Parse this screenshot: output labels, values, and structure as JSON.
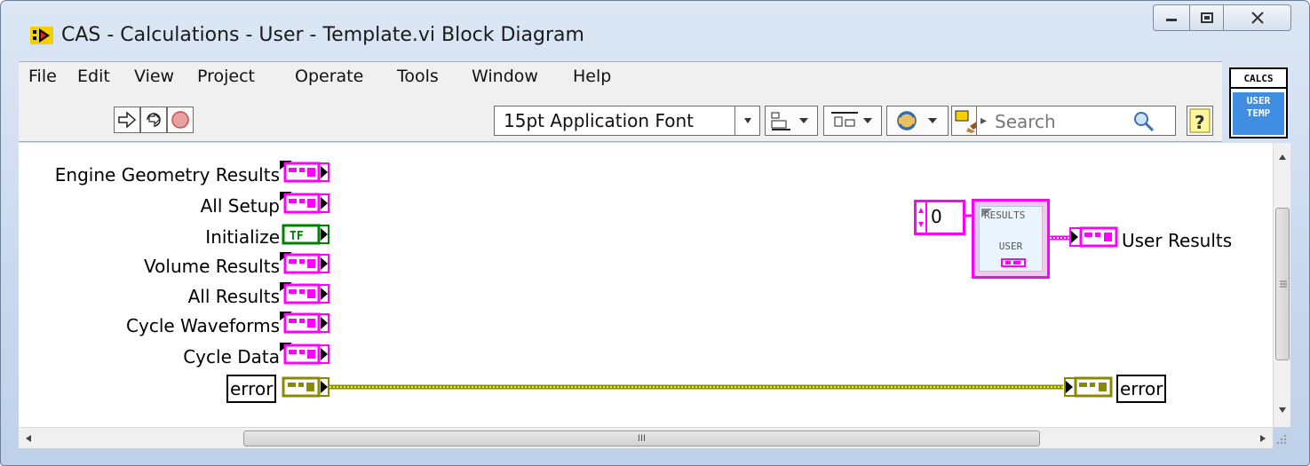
{
  "window": {
    "title": "CAS - Calculations - User - Template.vi Block Diagram",
    "controls": [
      "minimize",
      "maximize",
      "close"
    ]
  },
  "menu": [
    "File",
    "Edit",
    "View",
    "Project",
    "Operate",
    "Tools",
    "Window",
    "Help"
  ],
  "toolbar": {
    "font_select_value": "15pt Application Font",
    "search_placeholder": "Search"
  },
  "vi_icon": {
    "top": "CALCS",
    "bottom_line1": "USER",
    "bottom_line2": "TEMP"
  },
  "diagram": {
    "inputs": [
      {
        "label": "Engine Geometry Results",
        "type": "cluster",
        "color": "#ff00ff"
      },
      {
        "label": "All Setup",
        "type": "cluster",
        "color": "#ff00ff"
      },
      {
        "label": "Initialize",
        "type": "boolean",
        "glyph": "TF",
        "color": "#008000"
      },
      {
        "label": "Volume Results",
        "type": "cluster",
        "color": "#ff00ff"
      },
      {
        "label": "All Results",
        "type": "cluster",
        "color": "#ff00ff"
      },
      {
        "label": "Cycle Waveforms",
        "type": "cluster",
        "color": "#ff00ff"
      },
      {
        "label": "Cycle Data",
        "type": "cluster",
        "color": "#ff00ff"
      },
      {
        "label": "error",
        "type": "error-cluster",
        "color": "#8a8a00"
      }
    ],
    "numeric_constant": "0",
    "subvi": {
      "line1": "RESULTS",
      "line2": "USER"
    },
    "outputs": [
      {
        "label": "User Results",
        "color": "#ff00ff"
      },
      {
        "label": "error",
        "color": "#8a8a00"
      }
    ]
  },
  "hscroll_label": "III",
  "colors": {
    "cluster": "#ff00ff",
    "error_wire": "#8a8a00",
    "boolean": "#008000"
  }
}
